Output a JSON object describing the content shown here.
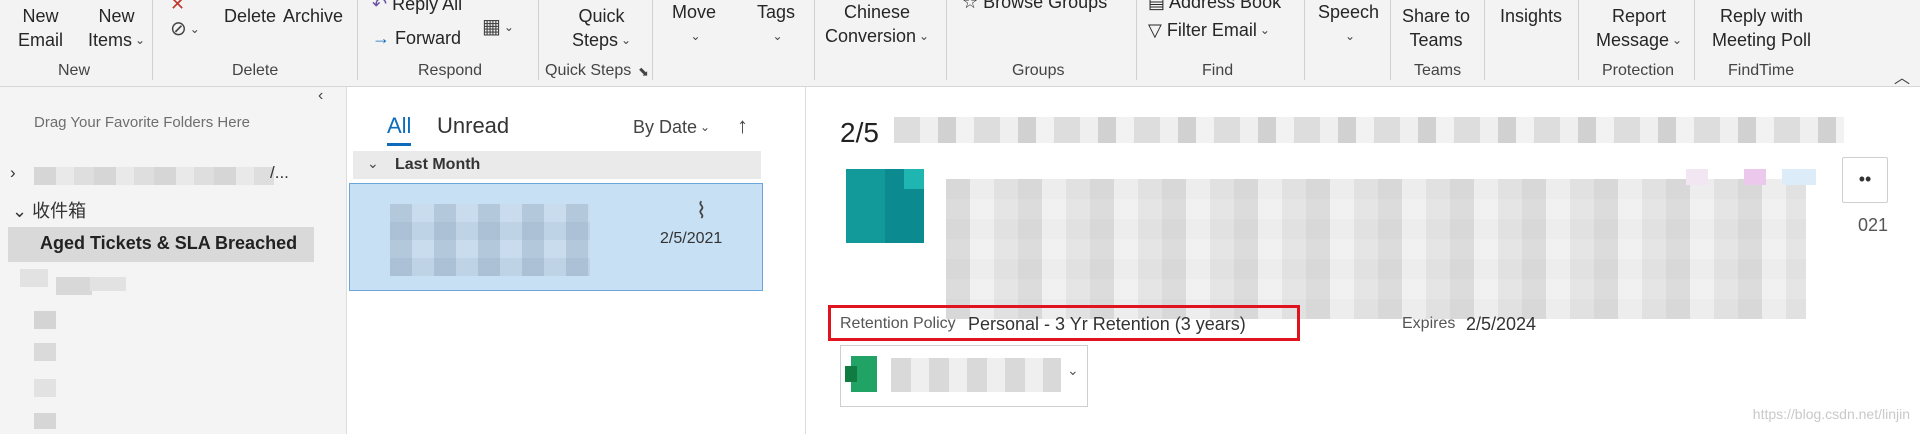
{
  "ribbon": {
    "new_email": "New\nEmail",
    "new_email_l1": "New",
    "new_email_l2": "Email",
    "new_items_l1": "New",
    "new_items_l2": "Items",
    "group_new": "New",
    "delete": "Delete",
    "archive": "Archive",
    "group_delete": "Delete",
    "reply_all": "Reply All",
    "forward": "Forward",
    "group_respond": "Respond",
    "quick_steps_l1": "Quick",
    "quick_steps_l2": "Steps",
    "group_quick_steps": "Quick Steps",
    "move": "Move",
    "tags": "Tags",
    "chinese_l1": "Chinese",
    "chinese_l2": "Conversion",
    "browse_groups": "Browse Groups",
    "group_groups": "Groups",
    "address_book": "Address Book",
    "filter_email": "Filter Email",
    "group_find": "Find",
    "speech": "Speech",
    "share_teams_l1": "Share to",
    "share_teams_l2": "Teams",
    "group_teams": "Teams",
    "insights": "Insights",
    "report_l1": "Report",
    "report_l2": "Message",
    "group_protection": "Protection",
    "reply_poll_l1": "Reply with",
    "reply_poll_l2": "Meeting Poll",
    "group_findtime": "FindTime"
  },
  "folders": {
    "drag_hint": "Drag Your Favorite Folders Here",
    "account_tail": "/...",
    "inbox": "收件箱",
    "selected": "Aged Tickets & SLA Breached"
  },
  "list": {
    "tab_all": "All",
    "tab_unread": "Unread",
    "sort": "By Date",
    "group_header": "Last Month",
    "message_date": "2/5/2021"
  },
  "reading": {
    "subject_prefix": "2/5",
    "date_tail": "021",
    "retention_label": "Retention Policy",
    "retention_value": "Personal - 3 Yr Retention (3 years)",
    "expires_label": "Expires",
    "expires_value": "2/5/2024"
  },
  "watermark": "https://blog.csdn.net/linjin",
  "colors": {
    "accent": "#0f6cbd",
    "selected_message": "#c7e0f4",
    "highlight_box": "#e0141e"
  }
}
